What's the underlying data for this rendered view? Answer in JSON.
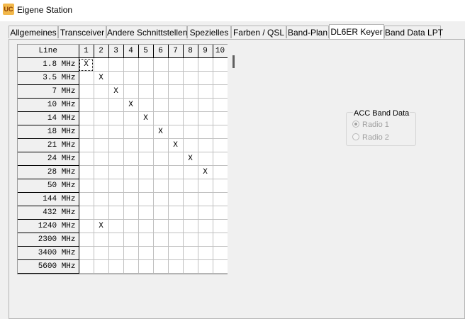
{
  "window": {
    "title": "Eigene Station",
    "icon": "app-logo-icon"
  },
  "tabs": [
    {
      "label": "Allgemeines",
      "active": false
    },
    {
      "label": "Transceiver",
      "active": false
    },
    {
      "label": "Andere Schnittstellen",
      "active": false
    },
    {
      "label": "Spezielles",
      "active": false
    },
    {
      "label": "Farben / QSL",
      "active": false
    },
    {
      "label": "Band-Plan",
      "active": false
    },
    {
      "label": "DL6ER Keyer",
      "active": true
    },
    {
      "label": "Band Data LPT",
      "active": false
    }
  ],
  "grid": {
    "corner_label": "Line",
    "columns": [
      "1",
      "2",
      "3",
      "4",
      "5",
      "6",
      "7",
      "8",
      "9",
      "10"
    ],
    "rows": [
      {
        "band": "1.8 MHz",
        "cells": [
          "X",
          "",
          "",
          "",
          "",
          "",
          "",
          "",
          "",
          ""
        ]
      },
      {
        "band": "3.5 MHz",
        "cells": [
          "",
          "X",
          "",
          "",
          "",
          "",
          "",
          "",
          "",
          ""
        ]
      },
      {
        "band": "7  MHz",
        "cells": [
          "",
          "",
          "X",
          "",
          "",
          "",
          "",
          "",
          "",
          ""
        ]
      },
      {
        "band": "10 MHz",
        "cells": [
          "",
          "",
          "",
          "X",
          "",
          "",
          "",
          "",
          "",
          ""
        ]
      },
      {
        "band": "14 MHz",
        "cells": [
          "",
          "",
          "",
          "",
          "X",
          "",
          "",
          "",
          "",
          ""
        ]
      },
      {
        "band": "18 MHz",
        "cells": [
          "",
          "",
          "",
          "",
          "",
          "X",
          "",
          "",
          "",
          ""
        ]
      },
      {
        "band": "21 MHz",
        "cells": [
          "",
          "",
          "",
          "",
          "",
          "",
          "X",
          "",
          "",
          ""
        ]
      },
      {
        "band": "24 MHz",
        "cells": [
          "",
          "",
          "",
          "",
          "",
          "",
          "",
          "X",
          "",
          ""
        ]
      },
      {
        "band": "28 MHz",
        "cells": [
          "",
          "",
          "",
          "",
          "",
          "",
          "",
          "",
          "X",
          ""
        ]
      },
      {
        "band": "50 MHz",
        "cells": [
          "",
          "",
          "",
          "",
          "",
          "",
          "",
          "",
          "",
          ""
        ]
      },
      {
        "band": "144 MHz",
        "cells": [
          "",
          "",
          "",
          "",
          "",
          "",
          "",
          "",
          "",
          ""
        ]
      },
      {
        "band": "432 MHz",
        "cells": [
          "",
          "",
          "",
          "",
          "",
          "",
          "",
          "",
          "",
          ""
        ]
      },
      {
        "band": "1240 MHz",
        "cells": [
          "",
          "X",
          "",
          "",
          "",
          "",
          "",
          "",
          "",
          ""
        ]
      },
      {
        "band": "2300 MHz",
        "cells": [
          "",
          "",
          "",
          "",
          "",
          "",
          "",
          "",
          "",
          ""
        ]
      },
      {
        "band": "3400 MHz",
        "cells": [
          "",
          "",
          "",
          "",
          "",
          "",
          "",
          "",
          "",
          ""
        ]
      },
      {
        "band": "5600 MHz",
        "cells": [
          "",
          "",
          "",
          "",
          "",
          "",
          "",
          "",
          "",
          ""
        ]
      },
      {
        "band": "",
        "cells": [
          "",
          "",
          "",
          "",
          "",
          "",
          "",
          "",
          "",
          ""
        ]
      }
    ]
  },
  "acc_band_data": {
    "title": "ACC Band Data",
    "options": [
      {
        "label": "Radio 1",
        "selected": true
      },
      {
        "label": "Radio 2",
        "selected": false
      }
    ],
    "enabled": false
  }
}
